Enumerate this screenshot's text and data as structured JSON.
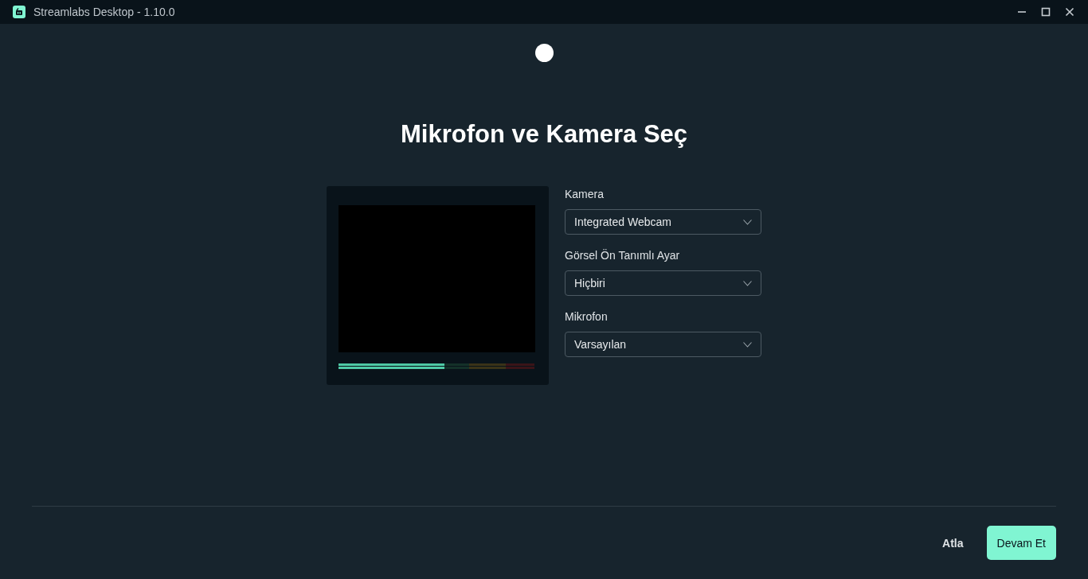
{
  "window": {
    "title": "Streamlabs Desktop - 1.10.0"
  },
  "heading": "Mikrofon ve Kamera Seç",
  "preview": {
    "meter": {
      "level": 0.54
    }
  },
  "fields": [
    {
      "label": "Kamera",
      "value": "Integrated Webcam"
    },
    {
      "label": "Görsel Ön Tanımlı Ayar",
      "value": "Hiçbiri"
    },
    {
      "label": "Mikrofon",
      "value": "Varsayılan"
    }
  ],
  "buttons": [
    {
      "label": "Atla",
      "kind": "link"
    },
    {
      "label": "Devam Et",
      "kind": "primary"
    }
  ]
}
